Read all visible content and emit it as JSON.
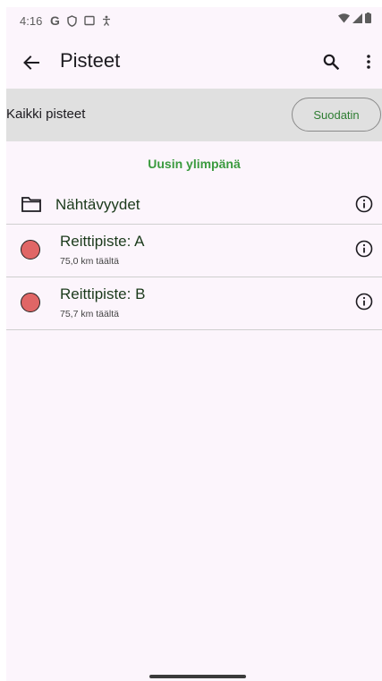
{
  "status_bar": {
    "time": "4:16"
  },
  "app_bar": {
    "title": "Pisteet"
  },
  "filter_bar": {
    "label": "Kaikki pisteet",
    "button_label": "Suodatin"
  },
  "sort_label": "Uusin ylimpänä",
  "folder": {
    "label": "Nähtävyydet"
  },
  "waypoints": [
    {
      "title": "Reittipiste: A",
      "distance": "75,0 km täältä",
      "color": "#e06666"
    },
    {
      "title": "Reittipiste: B",
      "distance": "75,7 km täältä",
      "color": "#e06666"
    }
  ],
  "colors": {
    "accent_green": "#3a9a3e",
    "background": "#fcf5fc",
    "filter_bar_bg": "#e0e0e0"
  }
}
